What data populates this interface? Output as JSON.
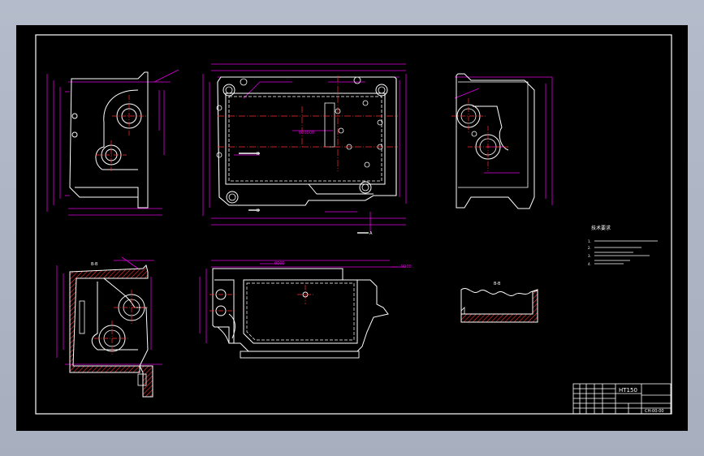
{
  "drawing": {
    "section_label_b": "B",
    "section_label_a": "A",
    "section_view_label": "B-B",
    "partial_view_label": "A-A",
    "partial_view_label_2": "B-B",
    "dimension_callout": "000000",
    "dimension_callout_2": "0000",
    "dimension_callout_3": "0000"
  },
  "notes": {
    "title": "技术要求",
    "items": [
      "1.",
      "2.",
      "3.",
      "4."
    ]
  },
  "title_block": {
    "part_number": "HT150",
    "drawing_code": "CH-00-00"
  },
  "colors": {
    "background": "#000000",
    "outline": "#ffffff",
    "dimension": "#e000e0",
    "centerline": "#ff3030",
    "hatch": "#ff3030",
    "inner_frame": "#ffffff",
    "screen_bg": "#b0b8c6"
  }
}
